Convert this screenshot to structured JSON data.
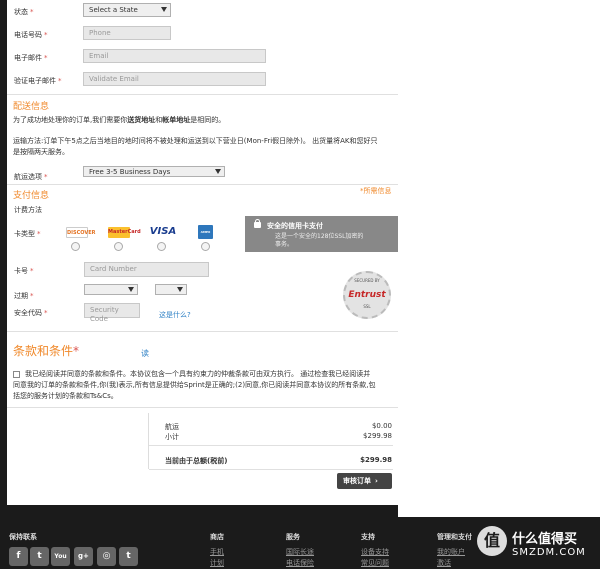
{
  "address": {
    "state_label": "状态",
    "state_value": "Select a State",
    "phone_label": "电话号码",
    "phone_placeholder": "Phone",
    "email_label": "电子邮件",
    "email_placeholder": "Email",
    "verify_email_label": "验证电子邮件",
    "verify_email_placeholder": "Validate Email"
  },
  "shipping": {
    "title": "配送信息",
    "note_pre": "为了成功地处理你的订单,我们需要你",
    "note_b1": "送货地址",
    "note_mid": "和",
    "note_b2": "帐单地址",
    "note_post": "是相同的。",
    "policy_line1": "运输方法:订单下午5点之后当地目的地时间将不被处理和运送到以下营业日(Mon-Fri假日除外)。 出货量将AK和您好只",
    "policy_line2": "是按隔两天服务。",
    "method_label": "航运选项",
    "method_value": "Free 3-5 Business Days"
  },
  "payment": {
    "title": "支付信息",
    "required_note": "*所需信息",
    "method_label": "计费方法",
    "card_type_label": "卡类型",
    "cards": [
      "DISCOVER",
      "MasterCard",
      "VISA",
      "AMEX"
    ],
    "secure_title": "安全的信用卡支付",
    "secure_text1": "这是一个安全的128位SSL加密的",
    "secure_text2": "事务。",
    "card_number_label": "卡号",
    "card_number_placeholder": "Card Number",
    "expiry_label": "过期",
    "security_code_label": "安全代码",
    "security_code_placeholder": "Security Code",
    "what_is_this": "这是什么?",
    "entrust_text": "Entrust",
    "entrust_sub": "SECURED BY",
    "entrust_ssl": "SSL"
  },
  "terms": {
    "title": "条款和条件",
    "read_link": "读",
    "line1": "我已经阅读并同意的条款和条件。本协议包含一个具有约束力的仲裁条款可由双方执行。 通过检查我已经阅读并",
    "line2": "同意我的订单的条款和条件,你(我)表示,所有信息提供给Sprint是正确的;(2)同意,你已阅读并同意本协议的所有条款,包",
    "line3": "括您的服务计划的条款和Ts&Cs。"
  },
  "summary": {
    "shipping_label": "航运",
    "shipping_value": "$0.00",
    "subtotal_label": "小计",
    "subtotal_value": "$299.98",
    "total_label": "当前由于总额(税前)",
    "total_value": "$299.98",
    "review_button": "审核订单"
  },
  "footer": {
    "col1_title": "保持联系",
    "social": [
      "f",
      "t",
      "You",
      "g+",
      "◎",
      "t"
    ],
    "col2_title": "商店",
    "col2_links": [
      "手机",
      "计划"
    ],
    "col3_title": "服务",
    "col3_links": [
      "国际长途",
      "电话保险"
    ],
    "col4_title": "支持",
    "col4_links": [
      "设备支持",
      "常见问题"
    ],
    "col5_title": "管理和支付",
    "col5_links": [
      "我的账户",
      "激活"
    ],
    "watermark_badge": "值",
    "watermark_title": "什么值得买",
    "watermark_url": "SMZDM.COM"
  },
  "colors": {
    "accent_orange": "#f0892b",
    "required_red": "#d9534f",
    "link_blue": "#2b7fc4"
  }
}
